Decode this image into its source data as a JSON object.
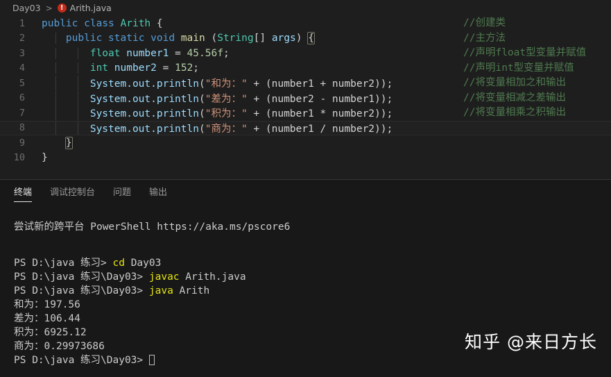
{
  "breadcrumb": {
    "folder": "Day03",
    "separator": ">",
    "error_icon": "error-circle-icon",
    "error_glyph": "!",
    "file": "Arith.java"
  },
  "editor": {
    "language": "java",
    "active_line": 8,
    "total_lines": 10,
    "line_numbers": [
      "1",
      "2",
      "3",
      "4",
      "5",
      "6",
      "7",
      "8",
      "9",
      "10"
    ],
    "lines": [
      {
        "n": "1",
        "text": "public class Arith {"
      },
      {
        "n": "2",
        "text": "    public static void main (String[] args) {"
      },
      {
        "n": "3",
        "text": "        float number1 = 45.56f;"
      },
      {
        "n": "4",
        "text": "        int number2 = 152;"
      },
      {
        "n": "5",
        "text": "        System.out.println(\"和为：\" + (number1 + number2));"
      },
      {
        "n": "6",
        "text": "        System.out.println(\"差为：\" + (number2 - number1));"
      },
      {
        "n": "7",
        "text": "        System.out.println(\"积为：\" + (number1 * number2));"
      },
      {
        "n": "8",
        "text": "        System.out.println(\"商为：\" + (number1 / number2));"
      },
      {
        "n": "9",
        "text": "    }"
      },
      {
        "n": "10",
        "text": "}"
      }
    ],
    "tokens": {
      "l1_public": "public",
      "l1_class": "class",
      "l1_name": "Arith",
      "l1_brace": "{",
      "l2_public": "public",
      "l2_static": "static",
      "l2_void": "void",
      "l2_main": "main",
      "l2_paren_open": "(",
      "l2_string": "String",
      "l2_brackets": "[]",
      "l2_args": "args",
      "l2_paren_close": ")",
      "l2_brace": "{",
      "l3_type": "float",
      "l3_var": "number1",
      "l3_eq": "=",
      "l3_val": "45.56f",
      "l3_semi": ";",
      "l4_type": "int",
      "l4_var": "number2",
      "l4_eq": "=",
      "l4_val": "152",
      "l4_semi": ";",
      "println_call": "System.out.println",
      "l5_str": "\"和为：\"",
      "l5_expr": "(number1 + number2));",
      "l6_str": "\"差为：\"",
      "l6_expr": "(number2 - number1));",
      "l7_str": "\"积为：\"",
      "l7_expr": "(number1 * number2));",
      "l8_str": "\"商为：\"",
      "l8_expr": "(number1 / number2));",
      "plus": "+",
      "l9_brace": "}",
      "l10_brace": "}"
    },
    "comments": [
      "//创建类",
      "//主方法",
      "//声明float型变量并赋值",
      "//声明int型变量并赋值",
      "//将变量相加之和输出",
      "//将变量相减之差输出",
      "//将变量相乘之积输出"
    ],
    "colors": {
      "background": "#1e1e1e",
      "active_line": "#212121",
      "keyword": "#569cd6",
      "type": "#4ec9b0",
      "function": "#dcdcaa",
      "number": "#b5cea8",
      "string": "#ce9178",
      "identifier": "#9cdcfe",
      "plain": "#d4d4d4",
      "comment": "#4f7a4f",
      "line_number": "#6e6e6e"
    }
  },
  "panel": {
    "tabs": [
      {
        "label": "终端",
        "active": true
      },
      {
        "label": "调试控制台",
        "active": false
      },
      {
        "label": "问题",
        "active": false
      },
      {
        "label": "输出",
        "active": false
      }
    ],
    "terminal": {
      "banner": "尝试新的跨平台 PowerShell https://aka.ms/pscore6",
      "entries": [
        {
          "prompt": "PS D:\\java 练习> ",
          "command": "cd",
          "args": " Day03"
        },
        {
          "prompt": "PS D:\\java 练习\\Day03> ",
          "command": "javac",
          "args": " Arith.java"
        },
        {
          "prompt": "PS D:\\java 练习\\Day03> ",
          "command": "java",
          "args": " Arith"
        }
      ],
      "output": [
        "和为：197.56",
        "差为：106.44",
        "积为：6925.12",
        "商为：0.29973686"
      ],
      "final_prompt": "PS D:\\java 练习\\Day03> ",
      "cursor": "block-cursor",
      "colors": {
        "background": "#181818",
        "text": "#cccccc",
        "command": "#e5e510"
      }
    }
  },
  "watermark": {
    "text": "知乎 @来日方长"
  }
}
